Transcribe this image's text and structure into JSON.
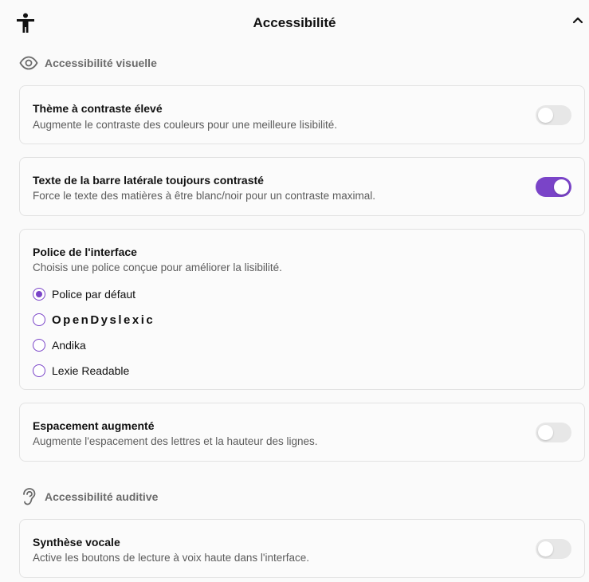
{
  "header": {
    "title": "Accessibilité",
    "icon": "accessibility-person-icon",
    "collapse_icon": "chevron-up-icon"
  },
  "sections": {
    "visual": {
      "label": "Accessibilité visuelle",
      "icon": "eye-icon"
    },
    "auditory": {
      "label": "Accessibilité auditive",
      "icon": "ear-icon"
    }
  },
  "settings": {
    "high_contrast": {
      "title": "Thème à contraste élevé",
      "description": "Augmente le contraste des couleurs pour une meilleure lisibilité.",
      "enabled": false
    },
    "sidebar_contrast": {
      "title": "Texte de la barre latérale toujours contrasté",
      "description": "Force le texte des matières à être blanc/noir pour un contraste maximal.",
      "enabled": true
    },
    "font": {
      "title": "Police de l'interface",
      "description": "Choisis une police conçue pour améliorer la lisibilité.",
      "selected": "Police par défaut",
      "options": [
        "Police par défaut",
        "OpenDyslexic",
        "Andika",
        "Lexie Readable"
      ]
    },
    "spacing": {
      "title": "Espacement augmenté",
      "description": "Augmente l'espacement des lettres et la hauteur des lignes.",
      "enabled": false
    },
    "tts": {
      "title": "Synthèse vocale",
      "description": "Active les boutons de lecture à voix haute dans l'interface.",
      "enabled": false
    }
  },
  "colors": {
    "accent": "#7a44c8",
    "toggle_off": "#e7e7e7",
    "muted_text": "#5c5c5c"
  }
}
